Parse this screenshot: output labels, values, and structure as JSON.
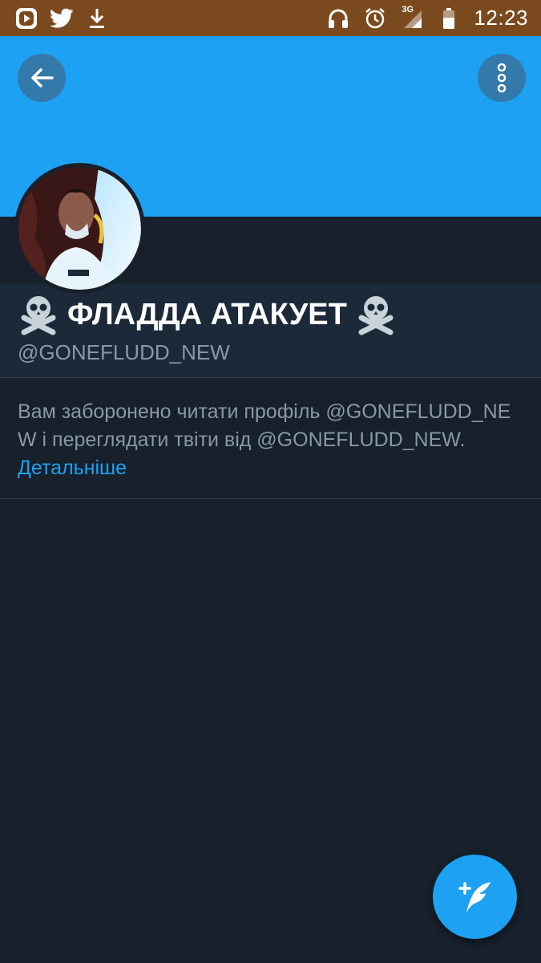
{
  "status_bar": {
    "time": "12:23",
    "network": "3G",
    "left_icons": [
      "video-player-icon",
      "twitter-bird-icon",
      "download-icon"
    ],
    "right_icons": [
      "headphones-icon",
      "alarm-icon",
      "signal-icon",
      "battery-icon"
    ]
  },
  "colors": {
    "status_bar": "#7a4a1e",
    "banner": "#1da1f2",
    "background": "#17202b",
    "panel": "#1c2938",
    "link": "#1da1f2",
    "muted_text": "#8899a6"
  },
  "profile": {
    "display_name": "ФЛАДДА АТАКУЕТ",
    "name_decoration": "☠",
    "handle": "@GONEFLUDD_NEW"
  },
  "blocked": {
    "message": "Вам заборонено читати профіль @GONEFLUDD_NEW і переглядати твіти від @GONEFLUDD_NEW.",
    "learn_more": "Детальніше"
  },
  "toolbar": {
    "back_icon": "arrow-left-icon",
    "more_icon": "more-vertical-icon"
  },
  "fab": {
    "icon": "compose-tweet-icon"
  }
}
